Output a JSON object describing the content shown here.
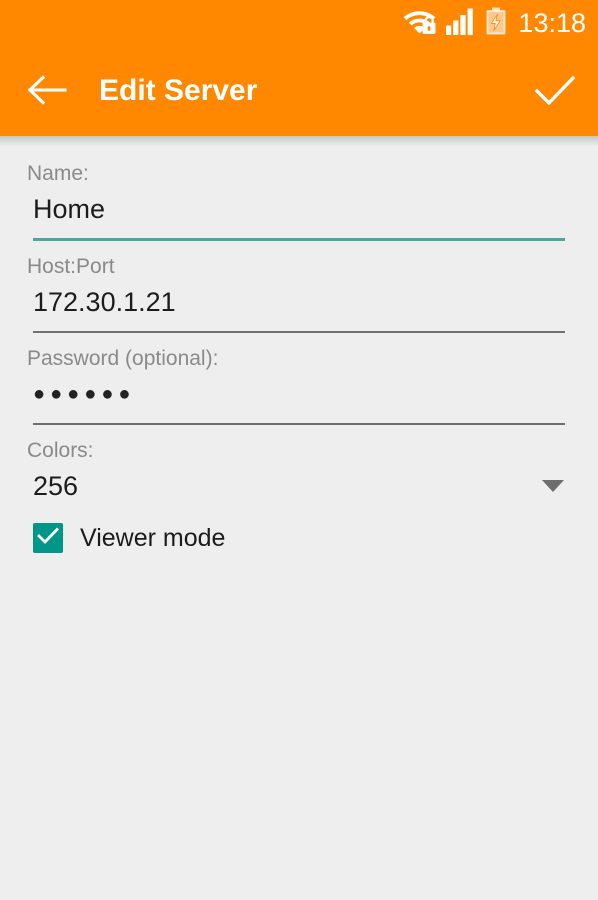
{
  "status_bar": {
    "time": "13:18",
    "icons": [
      {
        "name": "wifi-secured-icon",
        "label": "WiFi secured"
      },
      {
        "name": "cellular-signal-icon",
        "label": "Cellular signal full"
      },
      {
        "name": "battery-charging-icon",
        "label": "Battery charging"
      }
    ]
  },
  "app_bar": {
    "title": "Edit Server",
    "back_icon": "arrow-back-icon",
    "confirm_icon": "check-icon",
    "background_color": "#ff8800",
    "foreground_color": "#ffffff"
  },
  "form": {
    "fields": [
      {
        "key": "name",
        "label": "Name:",
        "value": "Home",
        "focused": true,
        "type": "text"
      },
      {
        "key": "host_port",
        "label": "Host:Port",
        "value": "172.30.1.21",
        "focused": false,
        "type": "text"
      },
      {
        "key": "password",
        "label": "Password (optional):",
        "value": "●●●●●●",
        "focused": false,
        "type": "password"
      },
      {
        "key": "colors",
        "label": "Colors:",
        "value": "256",
        "focused": false,
        "type": "select"
      }
    ],
    "checkbox": {
      "label": "Viewer mode",
      "checked": true,
      "color": "#009688"
    }
  },
  "theme": {
    "page_background": "#eeeeee",
    "accent_focused_underline": "#4aa8a0",
    "underline": "#6f6f6f",
    "label_color": "#8a8a8a",
    "value_color": "#1c1c1c"
  }
}
